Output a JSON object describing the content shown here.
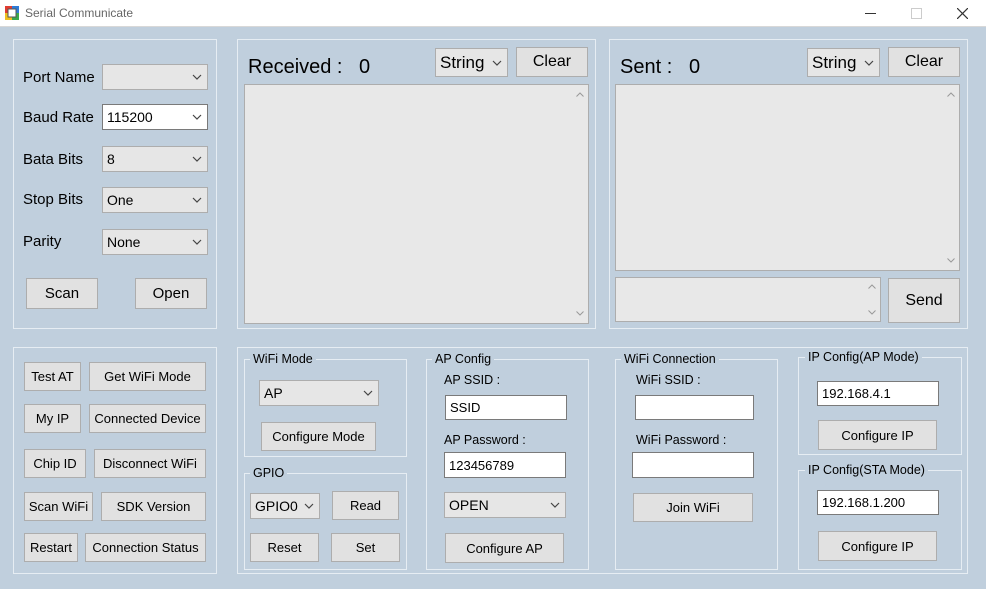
{
  "window": {
    "title": "Serial Communicate"
  },
  "serial": {
    "port_name_label": "Port Name",
    "port_name_value": "",
    "baud_rate_label": "Baud Rate",
    "baud_rate_value": "115200",
    "data_bits_label": "Bata Bits",
    "data_bits_value": "8",
    "stop_bits_label": "Stop Bits",
    "stop_bits_value": "One",
    "parity_label": "Parity",
    "parity_value": "None",
    "scan_label": "Scan",
    "open_label": "Open"
  },
  "received": {
    "label": "Received :",
    "count": "0",
    "format": "String",
    "clear_label": "Clear"
  },
  "sent": {
    "label": "Sent :",
    "count": "0",
    "format": "String",
    "clear_label": "Clear",
    "input_value": "",
    "send_label": "Send"
  },
  "commands": {
    "test_at": "Test AT",
    "get_wifi_mode": "Get WiFi Mode",
    "my_ip": "My IP",
    "connected_device": "Connected Device",
    "chip_id": "Chip ID",
    "disconnect_wifi": "Disconnect WiFi",
    "scan_wifi": "Scan WiFi",
    "sdk_version": "SDK Version",
    "restart": "Restart",
    "connection_status": "Connection Status"
  },
  "wifi_mode": {
    "title": "WiFi Mode",
    "value": "AP",
    "configure_label": "Configure Mode"
  },
  "gpio": {
    "title": "GPIO",
    "pin_value": "GPIO0",
    "read_label": "Read",
    "reset_label": "Reset",
    "set_label": "Set"
  },
  "ap_config": {
    "title": "AP Config",
    "ssid_label": "AP SSID :",
    "ssid_value": "SSID",
    "password_label": "AP Password :",
    "password_value": "123456789",
    "encryption_value": "OPEN",
    "configure_label": "Configure AP"
  },
  "wifi_connection": {
    "title": "WiFi Connection",
    "ssid_label": "WiFi SSID :",
    "ssid_value": "",
    "password_label": "WiFi Password :",
    "password_value": "",
    "join_label": "Join WiFi"
  },
  "ip_ap": {
    "title": "IP Config(AP Mode)",
    "value": "192.168.4.1",
    "configure_label": "Configure IP"
  },
  "ip_sta": {
    "title": "IP Config(STA Mode)",
    "value": "192.168.1.200",
    "configure_label": "Configure IP"
  },
  "icons": [
    "app-icon",
    "minimize-icon",
    "maximize-icon",
    "close-icon",
    "chevron-down-icon",
    "scroll-up-icon",
    "scroll-down-icon"
  ]
}
